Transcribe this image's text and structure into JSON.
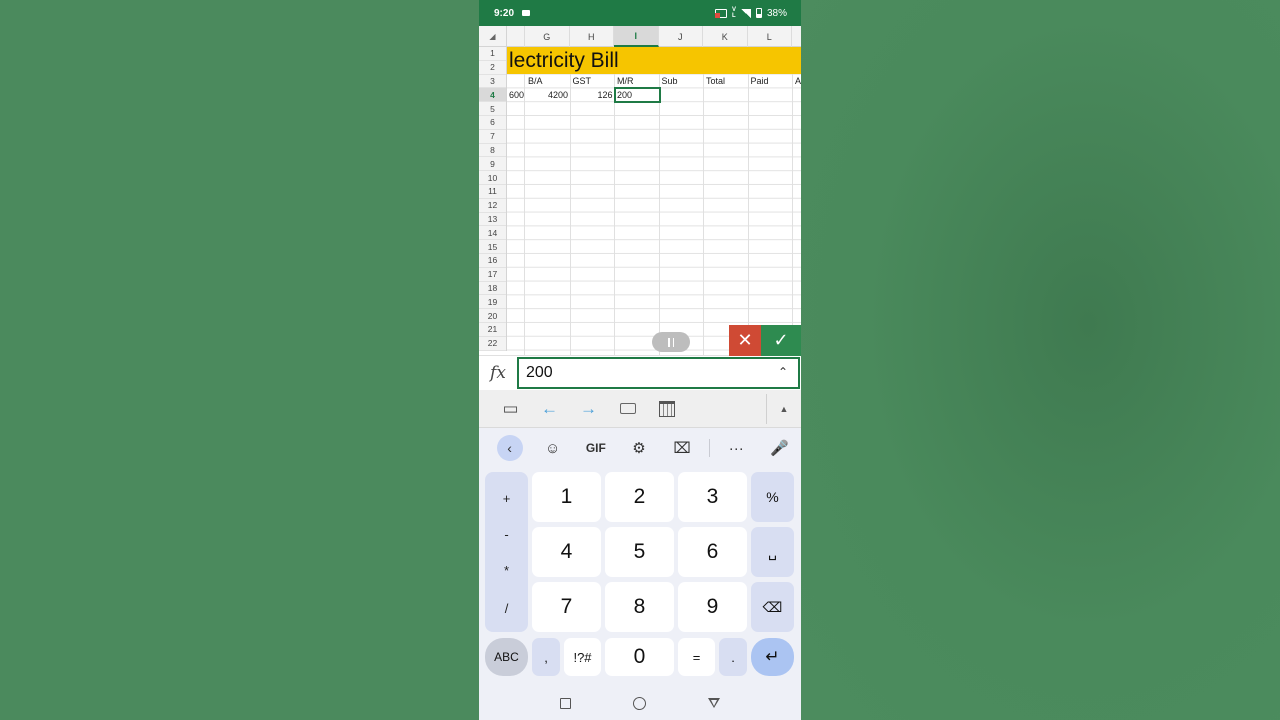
{
  "status_bar": {
    "time": "9:20",
    "battery": "38%"
  },
  "sheet": {
    "columns": [
      {
        "label": ""
      },
      {
        "label": "G"
      },
      {
        "label": "H"
      },
      {
        "label": "I"
      },
      {
        "label": "J"
      },
      {
        "label": "K"
      },
      {
        "label": "L"
      }
    ],
    "rows": [
      "1",
      "2",
      "3",
      "4",
      "5",
      "6",
      "7",
      "8",
      "9",
      "10",
      "11",
      "12",
      "13",
      "14",
      "15",
      "16",
      "17",
      "18",
      "19",
      "20",
      "21",
      "22"
    ],
    "title": "lectricity Bill",
    "headers": {
      "g": "B/A",
      "h": "GST",
      "i": "M/R",
      "j": "Sub",
      "k": "Total",
      "l": "Paid",
      "m": "An"
    },
    "row4": {
      "f": "600",
      "g": "4200",
      "h": "126",
      "i": "200"
    },
    "selected_column": "I",
    "selected_row": "4"
  },
  "formula_bar": {
    "fx_label": "fx",
    "value": "200"
  },
  "keyboard": {
    "gif_label": "GIF",
    "digits": [
      "1",
      "2",
      "3",
      "4",
      "5",
      "6",
      "7",
      "8",
      "9",
      "0"
    ],
    "ops": [
      "+",
      "-",
      "*",
      "/"
    ],
    "percent": "%",
    "abc": "ABC",
    "comma": ",",
    "symbols": "!?#",
    "equals": "=",
    "period": "."
  }
}
